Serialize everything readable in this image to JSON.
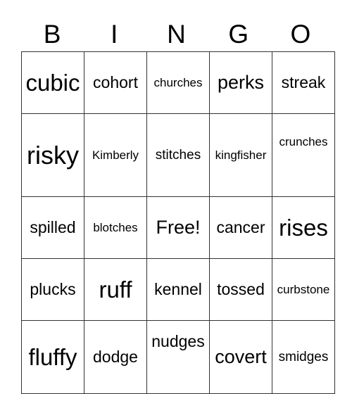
{
  "header": [
    "B",
    "I",
    "N",
    "G",
    "O"
  ],
  "rows": [
    [
      "cubic",
      "cohort",
      "churches",
      "perks",
      "streak"
    ],
    [
      "risky",
      "Kimberly",
      "stitches",
      "kingfisher",
      "crunches"
    ],
    [
      "spilled",
      "blotches",
      "Free!",
      "cancer",
      "rises"
    ],
    [
      "plucks",
      "ruff",
      "kennel",
      "tossed",
      "curbstone"
    ],
    [
      "fluffy",
      "dodge",
      "nudges",
      "covert",
      "smidges"
    ]
  ]
}
